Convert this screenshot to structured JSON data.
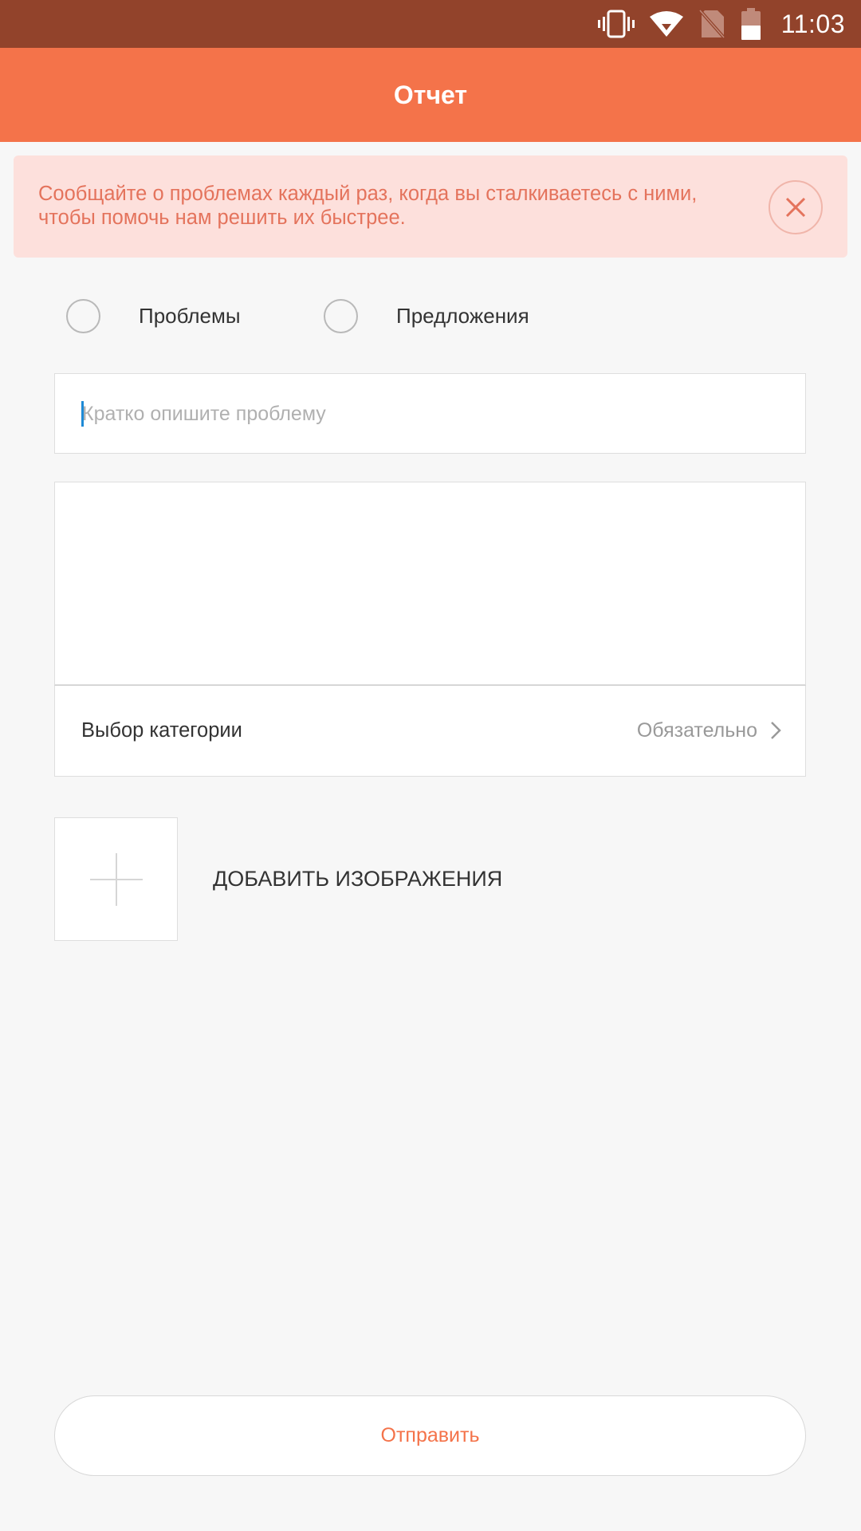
{
  "status_bar": {
    "time": "11:03",
    "icons": [
      "vibrate-icon",
      "wifi-icon",
      "no-sim-icon",
      "battery-icon"
    ]
  },
  "header": {
    "title": "Отчет"
  },
  "notice": {
    "text": "Сообщайте о проблемах каждый раз, когда вы сталкиваетесь с ними, чтобы помочь нам решить их быстрее."
  },
  "type_selector": {
    "options": [
      {
        "label": "Проблемы",
        "selected": false
      },
      {
        "label": "Предложения",
        "selected": false
      }
    ]
  },
  "form": {
    "title_placeholder": "Кратко опишите проблему",
    "description_value": "",
    "category_label": "Выбор категории",
    "category_value": "Обязательно",
    "add_images_label": "ДОБАВИТЬ ИЗОБРАЖЕНИЯ"
  },
  "actions": {
    "submit_label": "Отправить"
  },
  "colors": {
    "status_bar": "#92432b",
    "accent": "#f4734a",
    "notice_bg": "#fde0dc",
    "notice_text": "#e4735c",
    "background": "#f7f7f7"
  }
}
